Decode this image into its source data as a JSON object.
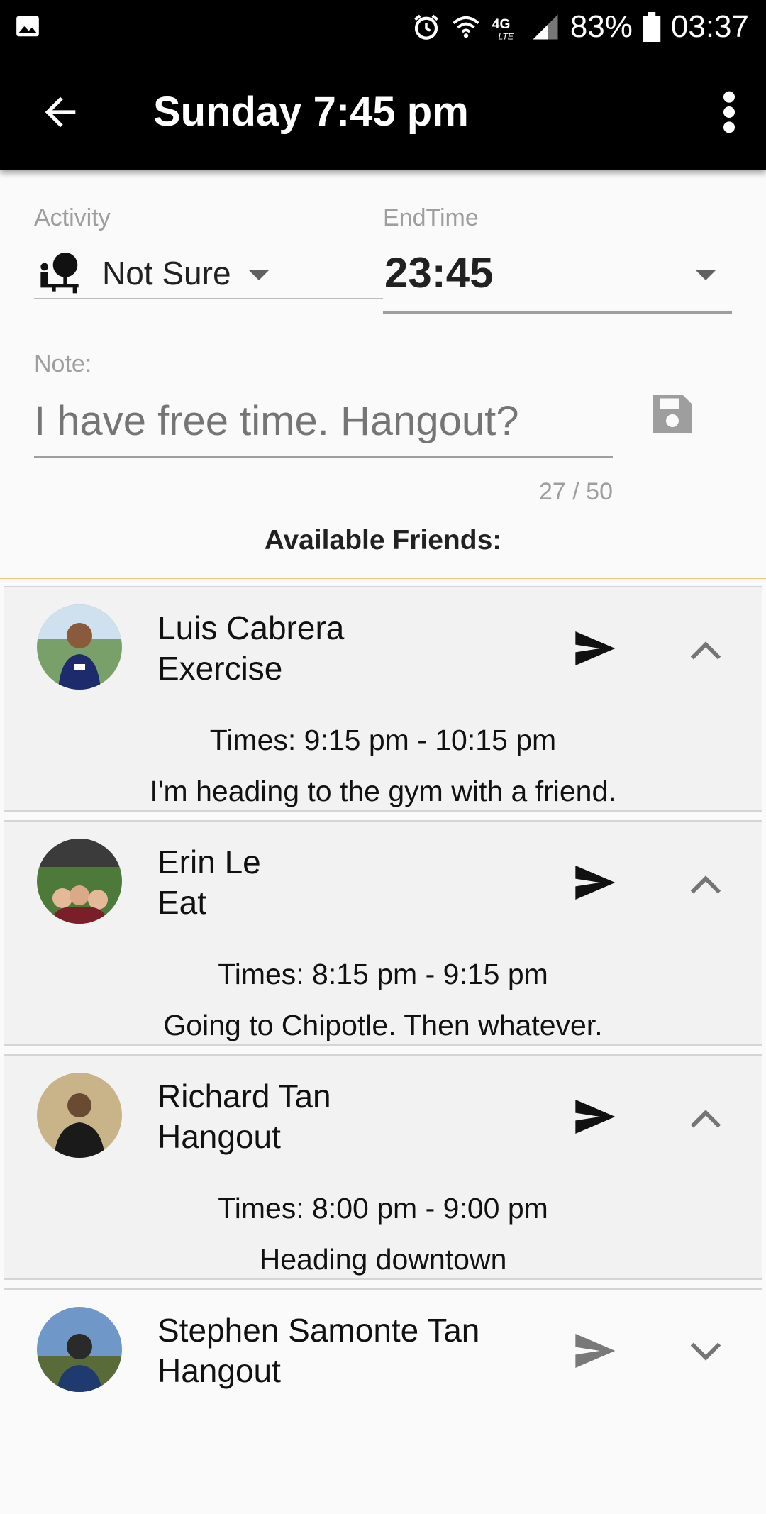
{
  "status_bar": {
    "battery": "83%",
    "time": "03:37",
    "network": "4G LTE",
    "icons": [
      "image-icon",
      "alarm-icon",
      "wifi-icon",
      "signal-icon",
      "battery-icon"
    ]
  },
  "app_bar": {
    "title": "Sunday 7:45 pm",
    "back_icon": "arrow-back-icon",
    "menu_icon": "more-vert-icon"
  },
  "form": {
    "activity_label": "Activity",
    "activity_value": "Not Sure",
    "endtime_label": "EndTime",
    "endtime_value": "23:45",
    "note_label": "Note:",
    "note_placeholder": "I have free time. Hangout?",
    "note_counter": "27 / 50",
    "available_title": "Available Friends:"
  },
  "colors": {
    "accent_divider": "#f5c27a",
    "appbar": "#000000",
    "card_bg": "#f2f2f2"
  },
  "friends": [
    {
      "name": "Luis Cabrera",
      "activity": "Exercise",
      "times": "Times: 9:15 pm - 10:15 pm",
      "note": "I'm heading to the gym with a friend.",
      "expanded": true
    },
    {
      "name": "Erin Le",
      "activity": "Eat",
      "times": "Times: 8:15 pm - 9:15 pm",
      "note": "Going to Chipotle. Then whatever.",
      "expanded": true
    },
    {
      "name": "Richard Tan",
      "activity": "Hangout",
      "times": "Times: 8:00 pm - 9:00 pm",
      "note": "Heading downtown",
      "expanded": true
    },
    {
      "name": "Stephen Samonte Tan",
      "activity": "Hangout",
      "expanded": false
    }
  ]
}
